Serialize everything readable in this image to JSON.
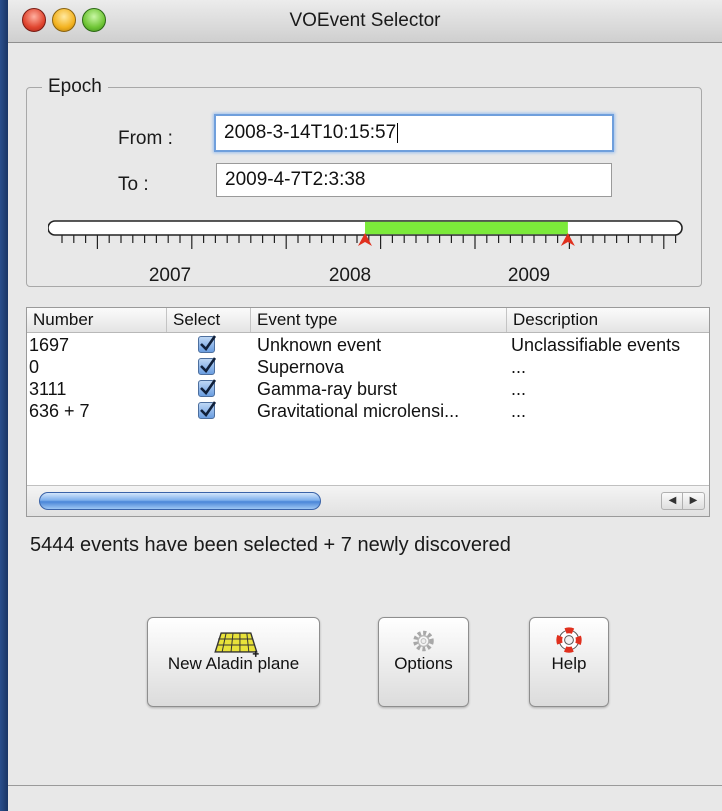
{
  "window": {
    "title": "VOEvent Selector"
  },
  "epoch": {
    "legend": "Epoch",
    "from_label": "From :",
    "from_value": "2008-3-14T10:15:57",
    "to_label": "To :",
    "to_value": "2009-4-7T2:3:38",
    "timeline": {
      "year_labels": [
        "2007",
        "2008",
        "2009"
      ],
      "selection_start_fraction": 0.5,
      "selection_end_fraction": 0.82,
      "selection_color": "#7cea3a",
      "marker_color": "#e0301e"
    }
  },
  "table": {
    "columns": [
      "Number",
      "Select",
      "Event type",
      "Description"
    ],
    "rows": [
      {
        "number": "1697",
        "selected": true,
        "event_type": "Unknown event",
        "description": "Unclassifiable events"
      },
      {
        "number": "0",
        "selected": true,
        "event_type": "Supernova",
        "description": "..."
      },
      {
        "number": "3111",
        "selected": true,
        "event_type": "Gamma-ray burst",
        "description": "..."
      },
      {
        "number": "636 + 7",
        "selected": true,
        "event_type": "Gravitational microlensi...",
        "description": "..."
      }
    ]
  },
  "status": "5444 events have been selected + 7 newly discovered",
  "buttons": {
    "new_plane": {
      "label": "New Aladin plane",
      "icon": "aladin-plane-icon"
    },
    "options": {
      "label": "Options",
      "icon": "gear-icon"
    },
    "help": {
      "label": "Help",
      "icon": "lifebuoy-icon"
    }
  }
}
